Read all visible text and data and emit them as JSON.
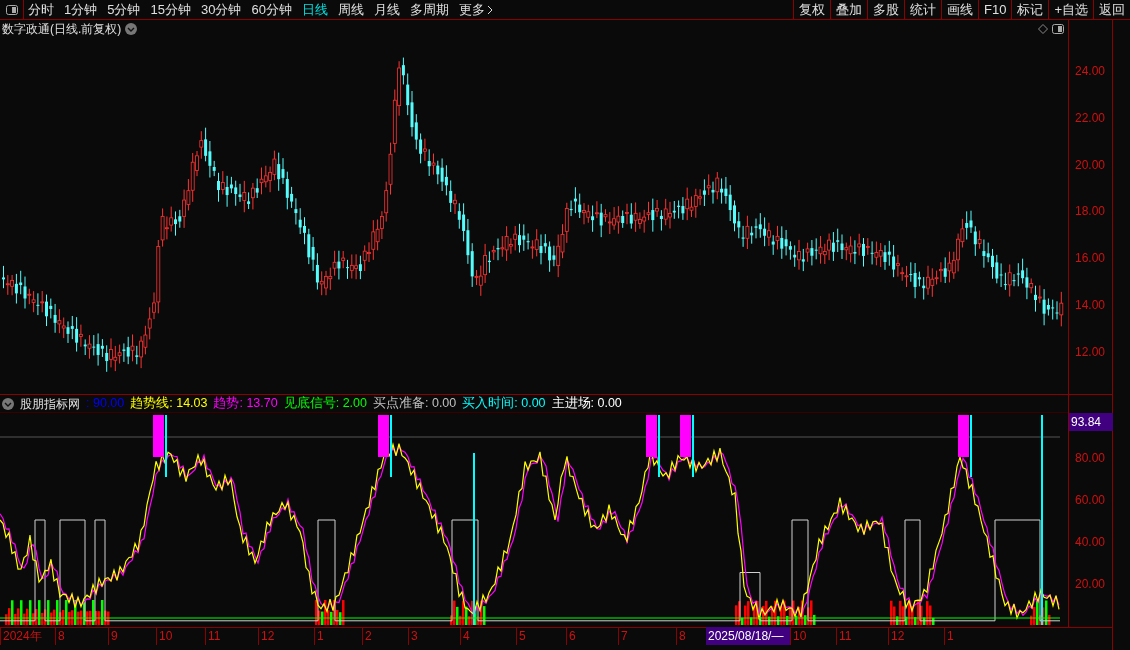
{
  "toolbar": {
    "periods": [
      {
        "label": "分时",
        "selected": false
      },
      {
        "label": "1分钟",
        "selected": false
      },
      {
        "label": "5分钟",
        "selected": false
      },
      {
        "label": "15分钟",
        "selected": false
      },
      {
        "label": "30分钟",
        "selected": false
      },
      {
        "label": "60分钟",
        "selected": false
      },
      {
        "label": "日线",
        "selected": true
      },
      {
        "label": "周线",
        "selected": false
      },
      {
        "label": "月线",
        "selected": false
      },
      {
        "label": "多周期",
        "selected": false
      }
    ],
    "more": "更多",
    "actions": [
      "复权",
      "叠加",
      "多股",
      "统计",
      "画线",
      "F10",
      "标记",
      "+自选",
      "返回"
    ]
  },
  "main_chart": {
    "title": "数字政通(日线.前复权)",
    "price_axis": [
      "24.00",
      "22.00",
      "20.00",
      "18.00",
      "16.00",
      "14.00",
      "12.00"
    ]
  },
  "indicator": {
    "name": "股朋指标网",
    "legend": [
      {
        "text": ": 90.00",
        "color": "#0000ff"
      },
      {
        "text": "趋势线: 14.03",
        "color": "#ffff00"
      },
      {
        "text": "趋势: 13.70",
        "color": "#ff00ff"
      },
      {
        "text": "见底信号: 2.00",
        "color": "#00ff00"
      },
      {
        "text": "买点准备: 0.00",
        "color": "#c0c0c0"
      },
      {
        "text": "买入时间: 0.00",
        "color": "#00ffff"
      },
      {
        "text": "主进场: 0.00",
        "color": "#ffffff"
      }
    ],
    "current_reading": "93.84",
    "axis": [
      "80.00",
      "60.00",
      "40.00",
      "20.00"
    ]
  },
  "date_axis": [
    {
      "label": "2024年",
      "kind": "tick"
    },
    {
      "label": "8",
      "kind": "tick"
    },
    {
      "label": "9",
      "kind": "tick"
    },
    {
      "label": "10",
      "kind": "tick"
    },
    {
      "label": "11",
      "kind": "tick"
    },
    {
      "label": "12",
      "kind": "tick"
    },
    {
      "label": "1",
      "kind": "tick"
    },
    {
      "label": "2",
      "kind": "tick"
    },
    {
      "label": "3",
      "kind": "tick"
    },
    {
      "label": "4",
      "kind": "tick"
    },
    {
      "label": "5",
      "kind": "tick"
    },
    {
      "label": "6",
      "kind": "tick"
    },
    {
      "label": "7",
      "kind": "tick"
    },
    {
      "label": "8",
      "kind": "tick"
    },
    {
      "label": "2025/08/18/—",
      "kind": "cursor"
    },
    {
      "label": "10",
      "kind": "tick"
    },
    {
      "label": "11",
      "kind": "tick"
    },
    {
      "label": "12",
      "kind": "tick"
    },
    {
      "label": "1",
      "kind": "tick"
    }
  ]
}
